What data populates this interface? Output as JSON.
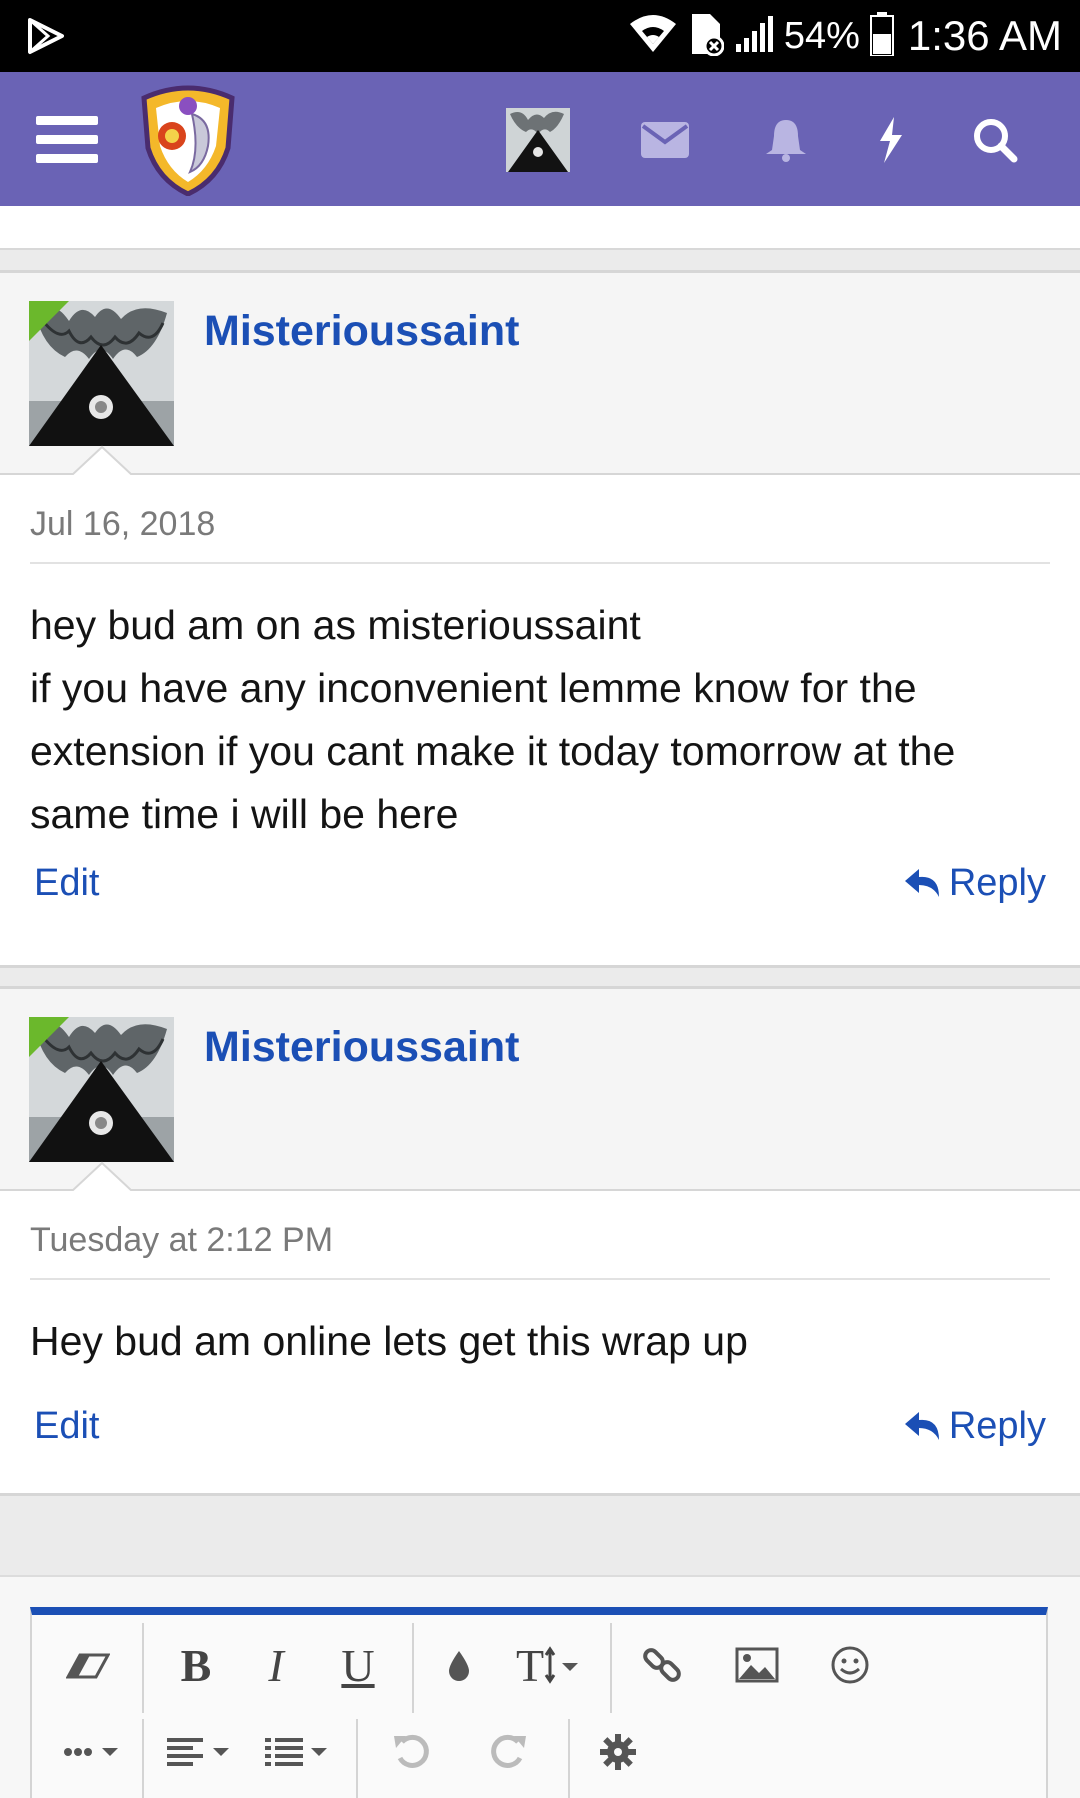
{
  "status_bar": {
    "battery": "54%",
    "time": "1:36 AM"
  },
  "header": {
    "icons": [
      "menu-icon",
      "site-logo",
      "user-avatar",
      "envelope-icon",
      "bell-icon",
      "bolt-icon",
      "search-icon"
    ]
  },
  "posts": [
    {
      "username": "Misterioussaint",
      "date": "Jul 16, 2018",
      "message": "hey bud am on as misterioussaint\nif you have any inconvenient lemme know for the extension if you cant make it today tomorrow at the same time i will be here",
      "edit_label": "Edit",
      "reply_label": "Reply"
    },
    {
      "username": "Misterioussaint",
      "date": "Tuesday at 2:12 PM",
      "message": "Hey bud am online lets get this wrap up",
      "edit_label": "Edit",
      "reply_label": "Reply"
    }
  ],
  "editor": {
    "bold_label": "B",
    "italic_label": "I",
    "underline_label": "U",
    "text_size_label": "T",
    "toolbar_icons": [
      "eraser-icon",
      "bold-icon",
      "italic-icon",
      "underline-icon",
      "text-color-icon",
      "text-size-icon",
      "link-icon",
      "image-icon",
      "smilie-icon",
      "more-icon",
      "align-icon",
      "list-icon",
      "undo-icon",
      "redo-icon",
      "settings-icon"
    ]
  },
  "colors": {
    "header_bg": "#6a63b5",
    "link_blue": "#1b4fb5",
    "online_badge": "#6bb82c"
  }
}
